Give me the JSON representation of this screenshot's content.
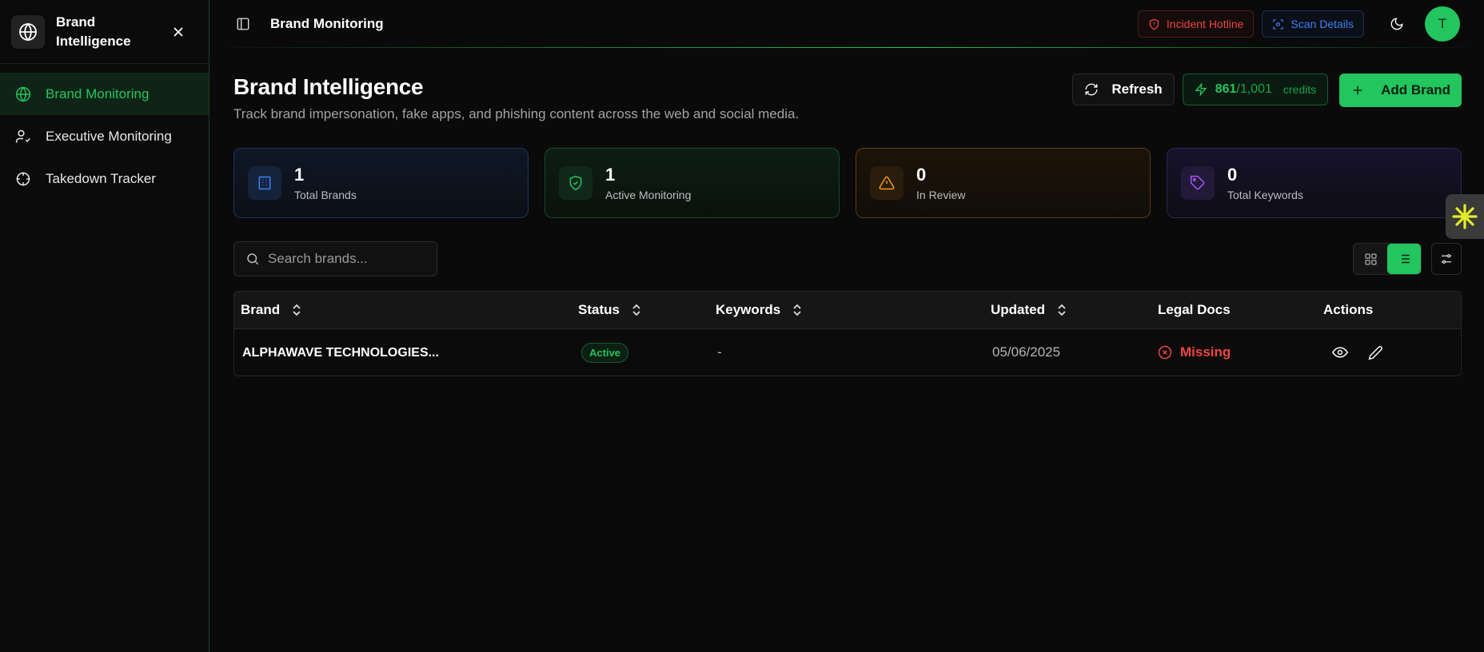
{
  "sidebar": {
    "app_title": "Brand Intelligence",
    "logo_icon": "globe-icon",
    "nav": [
      {
        "label": "Brand Monitoring",
        "icon": "globe-icon",
        "active": true
      },
      {
        "label": "Executive Monitoring",
        "icon": "user-check-icon",
        "active": false
      },
      {
        "label": "Takedown Tracker",
        "icon": "crosshair-icon",
        "active": false
      }
    ]
  },
  "topbar": {
    "title": "Brand Monitoring",
    "hotline_label": "Incident Hotline",
    "scan_label": "Scan Details",
    "avatar_initial": "T"
  },
  "page": {
    "title": "Brand Intelligence",
    "subtitle": "Track brand impersonation, fake apps, and phishing content across the web and social media.",
    "refresh_label": "Refresh",
    "credits_used": "861",
    "credits_total": "/1,001",
    "credits_label": "credits",
    "add_label": "Add Brand"
  },
  "stats": [
    {
      "value": "1",
      "label": "Total Brands",
      "icon": "building-icon",
      "color": "#3b82f6"
    },
    {
      "value": "1",
      "label": "Active Monitoring",
      "icon": "shield-check-icon",
      "color": "#22c55e"
    },
    {
      "value": "0",
      "label": "In Review",
      "icon": "alert-triangle-icon",
      "color": "#f59e0b"
    },
    {
      "value": "0",
      "label": "Total Keywords",
      "icon": "tag-icon",
      "color": "#a855f7"
    }
  ],
  "search": {
    "placeholder": "Search brands..."
  },
  "table": {
    "headers": [
      "Brand",
      "Status",
      "Keywords",
      "Updated",
      "Legal Docs",
      "Actions"
    ],
    "rows": [
      {
        "brand": "ALPHAWAVE TECHNOLOGIES...",
        "status": "Active",
        "keywords": "-",
        "updated": "05/06/2025",
        "legal_docs": "Missing"
      }
    ]
  },
  "colors": {
    "accent": "#22c55e",
    "danger": "#ef4444",
    "info": "#3b82f6",
    "warning": "#f59e0b",
    "purple": "#a855f7"
  }
}
